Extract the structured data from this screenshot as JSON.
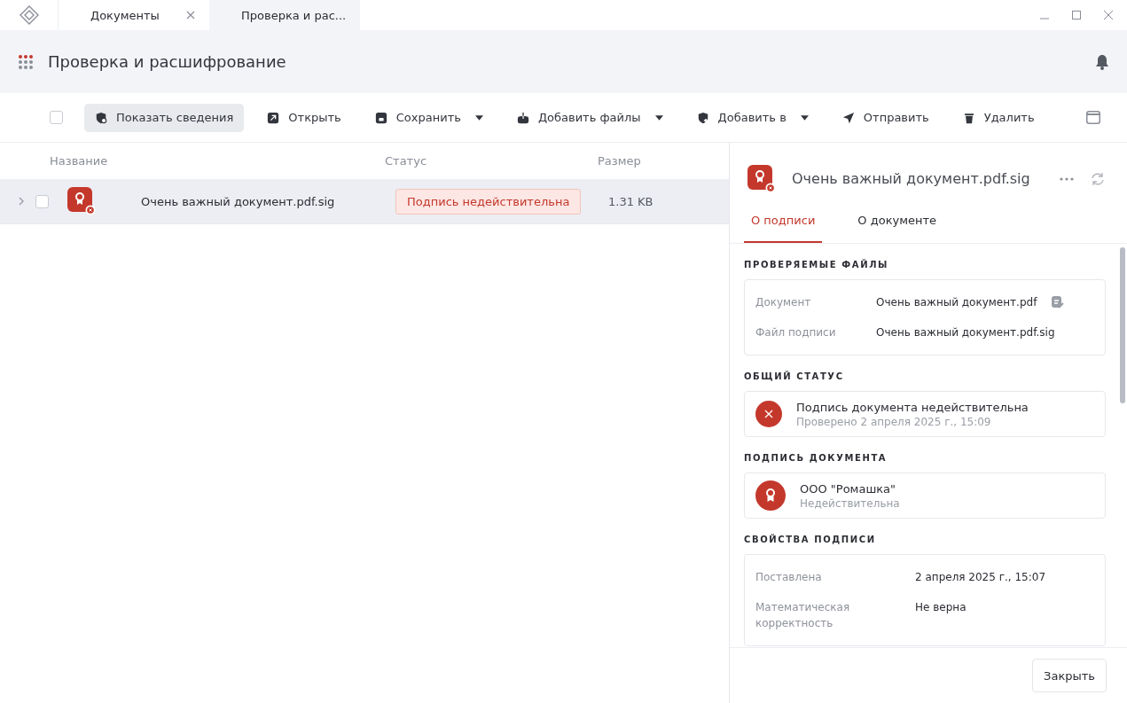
{
  "window": {
    "tabs": [
      {
        "label": "Документы",
        "selected": false
      },
      {
        "label": "Проверка и рас...",
        "selected": true
      }
    ]
  },
  "header": {
    "title": "Проверка и расшифрование"
  },
  "toolbar": {
    "select_all": {
      "checked": false
    },
    "buttons": [
      {
        "label": "Показать сведения",
        "selected": true,
        "dropdown": false
      },
      {
        "label": "Открыть",
        "selected": false,
        "dropdown": false
      },
      {
        "label": "Сохранить",
        "selected": false,
        "dropdown": true
      },
      {
        "label": "Добавить файлы",
        "selected": false,
        "dropdown": true
      },
      {
        "label": "Добавить в",
        "selected": false,
        "dropdown": true
      },
      {
        "label": "Отправить",
        "selected": false,
        "dropdown": false
      },
      {
        "label": "Удалить",
        "selected": false,
        "dropdown": false
      }
    ]
  },
  "table": {
    "columns": [
      "Название",
      "Статус",
      "Размер"
    ],
    "rows": [
      {
        "name": "Очень важный документ.pdf.sig",
        "status": "Подпись недействительна",
        "size": "1.31 KB",
        "selected": true,
        "checked": false,
        "expanded": false
      }
    ]
  },
  "details": {
    "title": "Очень важный документ.pdf.sig",
    "tabs": [
      {
        "label": "О подписи",
        "selected": true
      },
      {
        "label": "О документе",
        "selected": false
      }
    ],
    "sections": [
      {
        "title": "ПРОВЕРЯЕМЫЕ ФАЙЛЫ",
        "kind": "files",
        "rows": [
          {
            "label": "Документ",
            "value": "Очень важный документ.pdf",
            "action": true
          },
          {
            "label": "Файл подписи",
            "value": "Очень важный документ.pdf.sig",
            "action": false
          }
        ]
      },
      {
        "title": "ОБЩИЙ СТАТУС",
        "kind": "status",
        "primary": "Подпись документа недействительна",
        "secondary": "Проверено 2 апреля 2025 г., 15:09"
      },
      {
        "title": "ПОДПИСЬ ДОКУМЕНТА",
        "kind": "signer",
        "primary": "ООО \"Ромашка\"",
        "secondary": "Недействительна"
      },
      {
        "title": "СВОЙСТВА ПОДПИСИ",
        "kind": "properties",
        "rows": [
          {
            "label": "Поставлена",
            "value": "2 апреля 2025 г., 15:07"
          },
          {
            "label": "Математическая корректность",
            "value": "Не верна"
          }
        ]
      }
    ]
  },
  "footer": {
    "close_button": "Закрыть"
  }
}
